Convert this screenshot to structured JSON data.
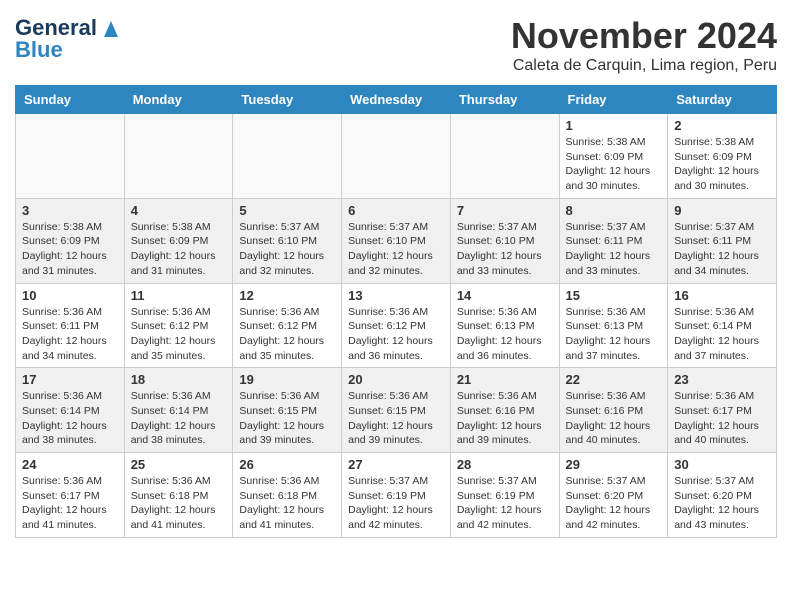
{
  "header": {
    "logo_line1": "General",
    "logo_line2": "Blue",
    "title": "November 2024",
    "subtitle": "Caleta de Carquin, Lima region, Peru"
  },
  "weekdays": [
    "Sunday",
    "Monday",
    "Tuesday",
    "Wednesday",
    "Thursday",
    "Friday",
    "Saturday"
  ],
  "weeks": [
    [
      {
        "day": "",
        "info": ""
      },
      {
        "day": "",
        "info": ""
      },
      {
        "day": "",
        "info": ""
      },
      {
        "day": "",
        "info": ""
      },
      {
        "day": "",
        "info": ""
      },
      {
        "day": "1",
        "info": "Sunrise: 5:38 AM\nSunset: 6:09 PM\nDaylight: 12 hours and 30 minutes."
      },
      {
        "day": "2",
        "info": "Sunrise: 5:38 AM\nSunset: 6:09 PM\nDaylight: 12 hours and 30 minutes."
      }
    ],
    [
      {
        "day": "3",
        "info": "Sunrise: 5:38 AM\nSunset: 6:09 PM\nDaylight: 12 hours and 31 minutes."
      },
      {
        "day": "4",
        "info": "Sunrise: 5:38 AM\nSunset: 6:09 PM\nDaylight: 12 hours and 31 minutes."
      },
      {
        "day": "5",
        "info": "Sunrise: 5:37 AM\nSunset: 6:10 PM\nDaylight: 12 hours and 32 minutes."
      },
      {
        "day": "6",
        "info": "Sunrise: 5:37 AM\nSunset: 6:10 PM\nDaylight: 12 hours and 32 minutes."
      },
      {
        "day": "7",
        "info": "Sunrise: 5:37 AM\nSunset: 6:10 PM\nDaylight: 12 hours and 33 minutes."
      },
      {
        "day": "8",
        "info": "Sunrise: 5:37 AM\nSunset: 6:11 PM\nDaylight: 12 hours and 33 minutes."
      },
      {
        "day": "9",
        "info": "Sunrise: 5:37 AM\nSunset: 6:11 PM\nDaylight: 12 hours and 34 minutes."
      }
    ],
    [
      {
        "day": "10",
        "info": "Sunrise: 5:36 AM\nSunset: 6:11 PM\nDaylight: 12 hours and 34 minutes."
      },
      {
        "day": "11",
        "info": "Sunrise: 5:36 AM\nSunset: 6:12 PM\nDaylight: 12 hours and 35 minutes."
      },
      {
        "day": "12",
        "info": "Sunrise: 5:36 AM\nSunset: 6:12 PM\nDaylight: 12 hours and 35 minutes."
      },
      {
        "day": "13",
        "info": "Sunrise: 5:36 AM\nSunset: 6:12 PM\nDaylight: 12 hours and 36 minutes."
      },
      {
        "day": "14",
        "info": "Sunrise: 5:36 AM\nSunset: 6:13 PM\nDaylight: 12 hours and 36 minutes."
      },
      {
        "day": "15",
        "info": "Sunrise: 5:36 AM\nSunset: 6:13 PM\nDaylight: 12 hours and 37 minutes."
      },
      {
        "day": "16",
        "info": "Sunrise: 5:36 AM\nSunset: 6:14 PM\nDaylight: 12 hours and 37 minutes."
      }
    ],
    [
      {
        "day": "17",
        "info": "Sunrise: 5:36 AM\nSunset: 6:14 PM\nDaylight: 12 hours and 38 minutes."
      },
      {
        "day": "18",
        "info": "Sunrise: 5:36 AM\nSunset: 6:14 PM\nDaylight: 12 hours and 38 minutes."
      },
      {
        "day": "19",
        "info": "Sunrise: 5:36 AM\nSunset: 6:15 PM\nDaylight: 12 hours and 39 minutes."
      },
      {
        "day": "20",
        "info": "Sunrise: 5:36 AM\nSunset: 6:15 PM\nDaylight: 12 hours and 39 minutes."
      },
      {
        "day": "21",
        "info": "Sunrise: 5:36 AM\nSunset: 6:16 PM\nDaylight: 12 hours and 39 minutes."
      },
      {
        "day": "22",
        "info": "Sunrise: 5:36 AM\nSunset: 6:16 PM\nDaylight: 12 hours and 40 minutes."
      },
      {
        "day": "23",
        "info": "Sunrise: 5:36 AM\nSunset: 6:17 PM\nDaylight: 12 hours and 40 minutes."
      }
    ],
    [
      {
        "day": "24",
        "info": "Sunrise: 5:36 AM\nSunset: 6:17 PM\nDaylight: 12 hours and 41 minutes."
      },
      {
        "day": "25",
        "info": "Sunrise: 5:36 AM\nSunset: 6:18 PM\nDaylight: 12 hours and 41 minutes."
      },
      {
        "day": "26",
        "info": "Sunrise: 5:36 AM\nSunset: 6:18 PM\nDaylight: 12 hours and 41 minutes."
      },
      {
        "day": "27",
        "info": "Sunrise: 5:37 AM\nSunset: 6:19 PM\nDaylight: 12 hours and 42 minutes."
      },
      {
        "day": "28",
        "info": "Sunrise: 5:37 AM\nSunset: 6:19 PM\nDaylight: 12 hours and 42 minutes."
      },
      {
        "day": "29",
        "info": "Sunrise: 5:37 AM\nSunset: 6:20 PM\nDaylight: 12 hours and 42 minutes."
      },
      {
        "day": "30",
        "info": "Sunrise: 5:37 AM\nSunset: 6:20 PM\nDaylight: 12 hours and 43 minutes."
      }
    ]
  ]
}
